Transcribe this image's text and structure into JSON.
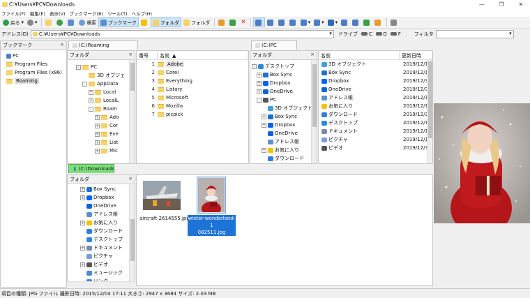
{
  "window": {
    "title": "C:¥Users¥PC¥Downloads",
    "min": "—",
    "max": "❐",
    "close": "✕"
  },
  "menu": [
    "ファイル(F)",
    "編集(E)",
    "表示(V)",
    "ブックマーク(B)",
    "ツール(T)",
    "ヘルプ(H)"
  ],
  "toolbar": {
    "back": "戻る",
    "search": "検索",
    "bookmark": "ブックマーク",
    "folder1": "フォルダ",
    "folder2": "フォルダ"
  },
  "address": {
    "label": "アドレス(D)",
    "value": "C:¥Users¥PC¥Downloads",
    "drive_label": "ドライブ",
    "drive_c": "C",
    "drive_d": "D",
    "drive_f": "F",
    "filter_label": "フィルタ"
  },
  "bookmarks": {
    "title": "ブックマーク",
    "items": [
      {
        "label": "PC",
        "icon": "pc-icon"
      },
      {
        "label": "Program Files",
        "icon": "folder-icon"
      },
      {
        "label": "Program Files (x86)",
        "icon": "folder-icon"
      },
      {
        "label": "Roaming",
        "icon": "folder-icon",
        "selected": true
      }
    ]
  },
  "pane1": {
    "tab": "(C:)Roaming",
    "tree_title": "フォルダ",
    "tree": [
      {
        "label": "PC",
        "indent": 2,
        "exp": "-"
      },
      {
        "label": "3D オブジェ",
        "indent": 3,
        "exp": ""
      },
      {
        "label": "AppData",
        "indent": 3,
        "exp": "-"
      },
      {
        "label": "Local",
        "indent": 4,
        "exp": "+"
      },
      {
        "label": "LocalL",
        "indent": 4,
        "exp": "+"
      },
      {
        "label": "Roam",
        "indent": 4,
        "exp": "-"
      },
      {
        "label": "Ado",
        "indent": 5,
        "exp": "+"
      },
      {
        "label": "Cor",
        "indent": 5,
        "exp": "+"
      },
      {
        "label": "Eve",
        "indent": 5,
        "exp": "+"
      },
      {
        "label": "List",
        "indent": 5,
        "exp": "+"
      },
      {
        "label": "Mic",
        "indent": 5,
        "exp": "+"
      }
    ],
    "col_num": "番号",
    "col_name": "名前",
    "files": [
      {
        "num": "1",
        "name": "Adobe",
        "selected": true
      },
      {
        "num": "2",
        "name": "Corel"
      },
      {
        "num": "3",
        "name": "Everything"
      },
      {
        "num": "4",
        "name": "Listary"
      },
      {
        "num": "5",
        "name": "Microsoft"
      },
      {
        "num": "6",
        "name": "Mozilla"
      },
      {
        "num": "7",
        "name": "picpick"
      }
    ]
  },
  "pane2": {
    "tab": "(C:)PC",
    "tree_title": "フォルダ",
    "tree": [
      {
        "label": "デスクトップ",
        "indent": 0,
        "exp": "-",
        "color": "#2e86de"
      },
      {
        "label": "Box Sync",
        "indent": 1,
        "exp": "+",
        "color": "#1d6fd1"
      },
      {
        "label": "Dropbox",
        "indent": 1,
        "exp": "+",
        "color": "#0061fe"
      },
      {
        "label": "OneDrive",
        "indent": 1,
        "exp": "+",
        "color": "#0a64d6"
      },
      {
        "label": "PC",
        "indent": 1,
        "exp": "-",
        "color": "#555"
      },
      {
        "label": "3D オブジェクト",
        "indent": 2,
        "exp": "",
        "color": "#3aa0e0"
      },
      {
        "label": "Box Sync",
        "indent": 2,
        "exp": "+",
        "color": "#1d6fd1"
      },
      {
        "label": "Dropbox",
        "indent": 2,
        "exp": "+",
        "color": "#0061fe"
      },
      {
        "label": "OneDrive",
        "indent": 2,
        "exp": "",
        "color": "#0a64d6"
      },
      {
        "label": "アドレス帳",
        "indent": 2,
        "exp": "",
        "color": "#5b8fd1"
      },
      {
        "label": "お気に入り",
        "indent": 2,
        "exp": "+",
        "color": "#f2c200"
      },
      {
        "label": "ダウンロード",
        "indent": 2,
        "exp": "",
        "color": "#2f7fd9"
      }
    ],
    "col_name": "名前",
    "col_date": "更新日時",
    "files": [
      {
        "name": "3D オブジェクト",
        "date": "2019/12/1",
        "color": "#3aa0e0"
      },
      {
        "name": "Box Sync",
        "date": "2019/12/1",
        "color": "#1d6fd1"
      },
      {
        "name": "Dropbox",
        "date": "2019/12/3",
        "color": "#0061fe"
      },
      {
        "name": "OneDrive",
        "date": "2019/12/3",
        "color": "#0a64d6"
      },
      {
        "name": "アドレス帳",
        "date": "2019/12/1",
        "color": "#5b8fd1"
      },
      {
        "name": "お気に入り",
        "date": "2019/12/1",
        "color": "#f2c200"
      },
      {
        "name": "ダウンロード",
        "date": "2019/12/3",
        "color": "#2f7fd9"
      },
      {
        "name": "デスクトップ",
        "date": "2019/12/1",
        "color": "#2e86de"
      },
      {
        "name": "ドキュメント",
        "date": "2019/12/1",
        "color": "#7a8aa6"
      },
      {
        "name": "ピクチャ",
        "date": "2019/12/1",
        "color": "#7a9ed6"
      },
      {
        "name": "ビデオ",
        "date": "2019/12/3",
        "color": "#555"
      }
    ]
  },
  "pane3": {
    "tab": "(C:)Downloads",
    "tree_title": "フォルダ",
    "tree": [
      {
        "label": "Box Sync",
        "indent": 0,
        "exp": "+",
        "color": "#1d6fd1"
      },
      {
        "label": "Dropbox",
        "indent": 0,
        "exp": "+",
        "color": "#0061fe"
      },
      {
        "label": "OneDrive",
        "indent": 0,
        "exp": "",
        "color": "#0a64d6"
      },
      {
        "label": "アドレス帳",
        "indent": 0,
        "exp": "",
        "color": "#5b8fd1"
      },
      {
        "label": "お気に入り",
        "indent": 0,
        "exp": "+",
        "color": "#f2c200"
      },
      {
        "label": "ダウンロード",
        "indent": 0,
        "exp": "",
        "color": "#2f7fd9"
      },
      {
        "label": "デスクトップ",
        "indent": 0,
        "exp": "",
        "color": "#2e86de"
      },
      {
        "label": "ドキュメント",
        "indent": 0,
        "exp": "+",
        "color": "#7a8aa6"
      },
      {
        "label": "ピクチャ",
        "indent": 0,
        "exp": "",
        "color": "#7a9ed6"
      },
      {
        "label": "ビデオ",
        "indent": 0,
        "exp": "+",
        "color": "#555"
      },
      {
        "label": "ミュージック",
        "indent": 0,
        "exp": "",
        "color": "#4a8ad8"
      },
      {
        "label": "リンク",
        "indent": 0,
        "exp": "",
        "color": "#4a8ad8"
      }
    ],
    "thumbs": [
      {
        "name": "aircraft-2614555.jpg",
        "selected": false
      },
      {
        "name_line1": "winter-wonderland-1",
        "name_line2": "082511.jpg",
        "selected": true
      }
    ]
  },
  "status": "項目の種類: JPG ファイル 撮影日時: 2015/12/04 17:11 大きさ: 2947 x 3684 サイズ: 2.03 MB"
}
